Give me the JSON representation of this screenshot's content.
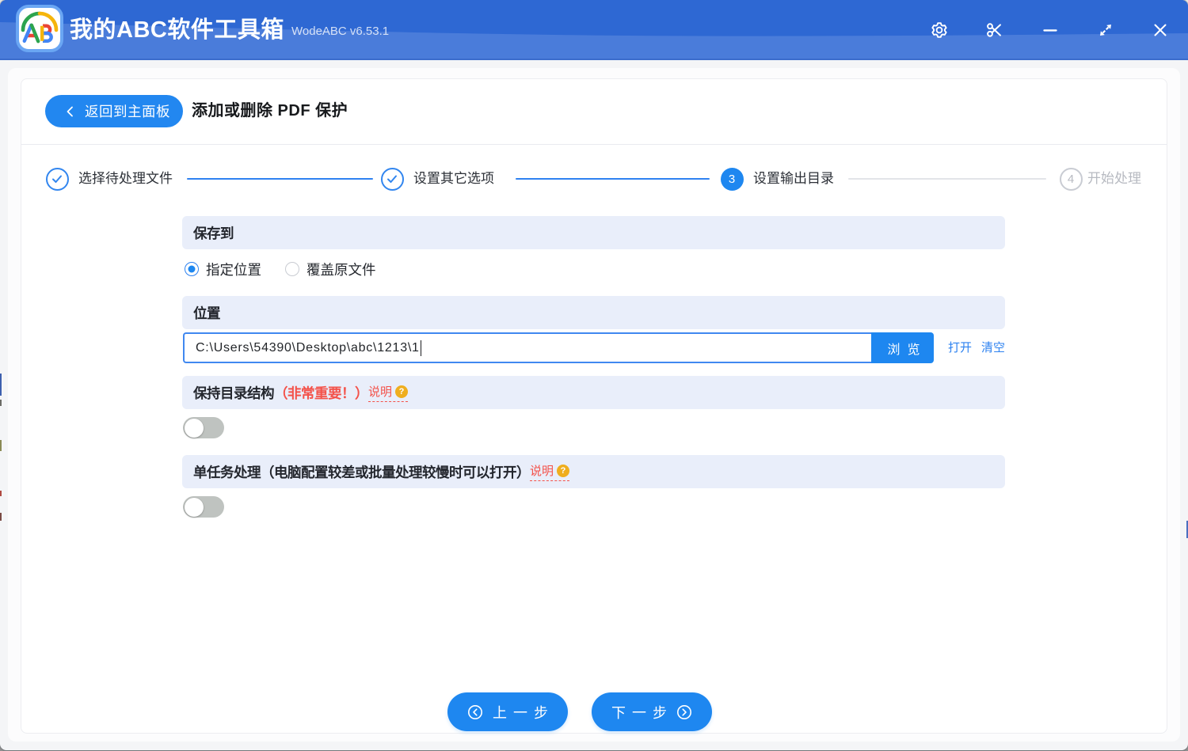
{
  "window": {
    "title": "我的ABC软件工具箱",
    "version": "WodeABC v6.53.1",
    "titlebar_icons": [
      "settings-gear",
      "scissors",
      "minimize",
      "maximize",
      "close"
    ]
  },
  "header": {
    "back_label": "返回到主面板",
    "page_title": "添加或删除 PDF 保护"
  },
  "stepper": {
    "steps": [
      {
        "label": "选择待处理文件",
        "state": "done"
      },
      {
        "label": "设置其它选项",
        "state": "done"
      },
      {
        "label": "设置输出目录",
        "state": "active",
        "number": "3"
      },
      {
        "label": "开始处理",
        "state": "wait",
        "number": "4"
      }
    ]
  },
  "form": {
    "save_to": {
      "title": "保存到",
      "options": [
        {
          "label": "指定位置",
          "selected": true
        },
        {
          "label": "覆盖原文件",
          "selected": false
        }
      ]
    },
    "location": {
      "title": "位置",
      "path_value": "C:\\Users\\54390\\Desktop\\abc\\1213\\1",
      "browse_label": "浏览",
      "open_label": "打开",
      "clear_label": "清空"
    },
    "keep_structure": {
      "title": "保持目录结构",
      "highlight": "（非常重要！）",
      "help_label": "说明",
      "enabled": false
    },
    "single_task": {
      "title": "单任务处理（电脑配置较差或批量处理较慢时可以打开）",
      "help_label": "说明",
      "enabled": false
    }
  },
  "footer": {
    "prev_label": "上一步",
    "next_label": "下一步"
  },
  "colors": {
    "accent_blue": "#1e87f0",
    "titlebar_dark": "#2e68d3",
    "titlebar_light": "#4a7cda",
    "section_bg": "#e9eefa",
    "danger_red": "#f4524a",
    "help_gold": "#efae1e"
  }
}
